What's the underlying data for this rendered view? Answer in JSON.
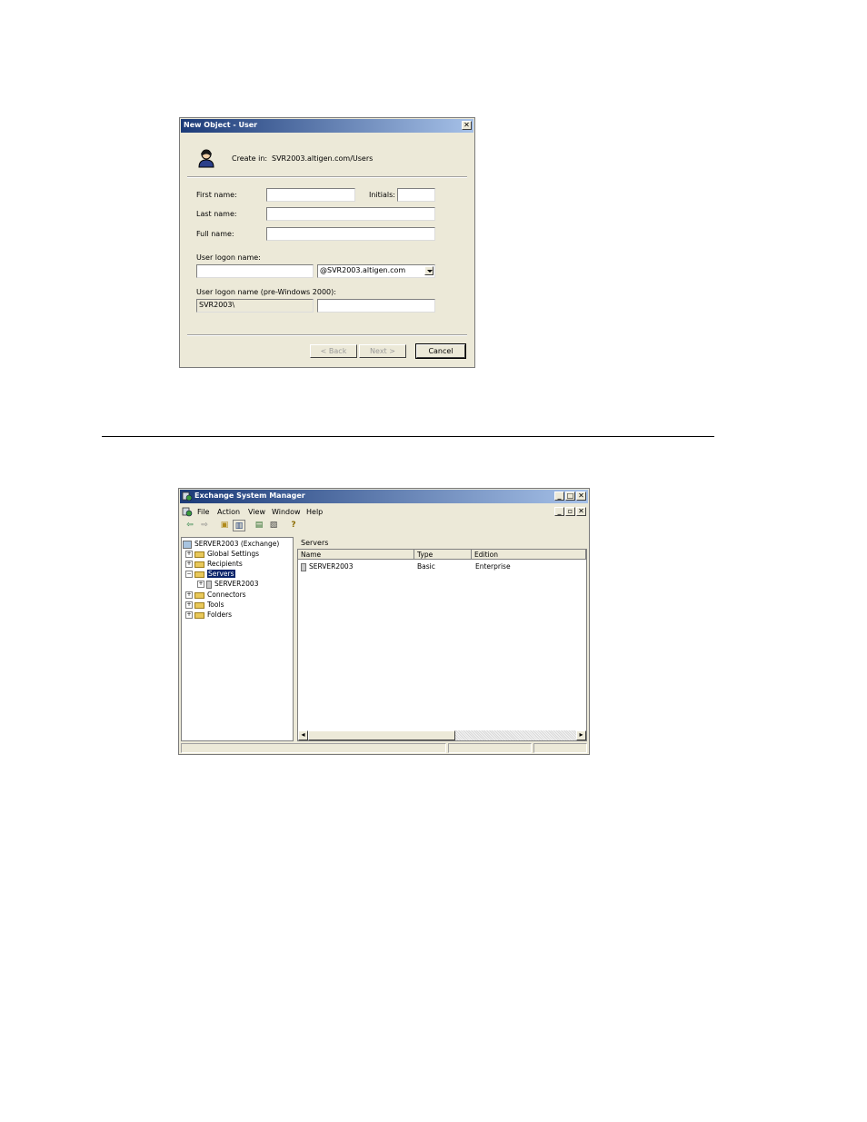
{
  "dialog": {
    "title": "New Object - User",
    "create_in_label": "Create in:",
    "create_in_value": "SVR2003.altigen.com/Users",
    "first_name_label": "First name:",
    "first_name_value": "",
    "initials_label": "Initials:",
    "initials_value": "",
    "last_name_label": "Last name:",
    "last_name_value": "",
    "full_name_label": "Full name:",
    "full_name_value": "",
    "logon_label": "User logon name:",
    "logon_value": "",
    "domain_value": "@SVR2003.altigen.com",
    "pre2000_label": "User logon name (pre-Windows 2000):",
    "pre2000_domain": "SVR2003\\",
    "pre2000_value": "",
    "back_label": "< Back",
    "next_label": "Next >",
    "cancel_label": "Cancel",
    "close_glyph": "✕"
  },
  "esm": {
    "title": "Exchange System Manager",
    "window_buttons": [
      "_",
      "□",
      "✕"
    ],
    "mdi_buttons": [
      "_",
      "▫",
      "✕"
    ],
    "menu": [
      "File",
      "Action",
      "View",
      "Window",
      "Help"
    ],
    "toolbar_icons": [
      "back-arrow-icon",
      "forward-arrow-icon",
      "up-folder-icon",
      "show-tree-icon",
      "properties-icon",
      "export-list-icon",
      "help-icon"
    ],
    "toolbar_glyphs": [
      "⇦",
      "⇨",
      "▣",
      "▥",
      "▤",
      "▧",
      "?"
    ],
    "tree": {
      "root": "SERVER2003 (Exchange)",
      "items": [
        {
          "label": "Global Settings",
          "expander": "+"
        },
        {
          "label": "Recipients",
          "expander": "+"
        },
        {
          "label": "Servers",
          "expander": "−"
        },
        {
          "label": "SERVER2003",
          "expander": "+"
        },
        {
          "label": "Connectors",
          "expander": "+"
        },
        {
          "label": "Tools",
          "expander": "+"
        },
        {
          "label": "Folders",
          "expander": "+"
        }
      ]
    },
    "list_title": "Servers",
    "columns": [
      "Name",
      "Type",
      "Edition"
    ],
    "rows": [
      {
        "name": "SERVER2003",
        "type": "Basic",
        "edition": "Enterprise"
      }
    ],
    "scroll_left": "◂",
    "scroll_right": "▸"
  },
  "colors": {
    "titlebar_start": "#1c3b78",
    "titlebar_end": "#a6c1e8",
    "selection": "#0a246a"
  }
}
